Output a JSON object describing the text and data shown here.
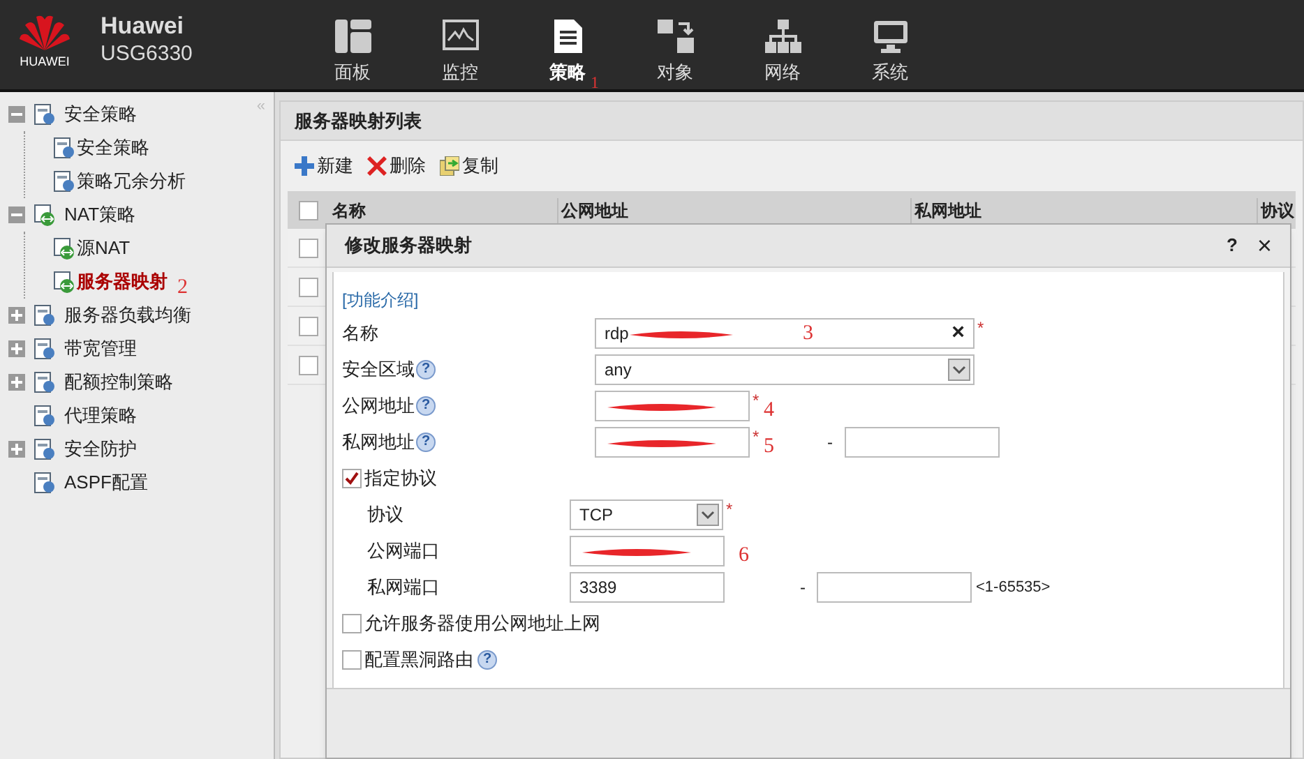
{
  "header": {
    "logo_text": "HUAWEI",
    "brand": "Huawei",
    "model": "USG6330",
    "nav": [
      {
        "label": "面板",
        "selected": false
      },
      {
        "label": "监控",
        "selected": false
      },
      {
        "label": "策略",
        "selected": true,
        "annotation": "1"
      },
      {
        "label": "对象",
        "selected": false
      },
      {
        "label": "网络",
        "selected": false
      },
      {
        "label": "系统",
        "selected": false
      }
    ]
  },
  "sidebar": {
    "collapse": "«",
    "items": [
      {
        "kind": "folder",
        "label": "安全策略",
        "expanded": true,
        "selected": false,
        "children": [
          {
            "label": "安全策略",
            "selected": false
          },
          {
            "label": "策略冗余分析",
            "selected": false
          }
        ]
      },
      {
        "kind": "folder",
        "label": "NAT策略",
        "expanded": true,
        "selected": false,
        "children": [
          {
            "label": "源NAT",
            "selected": false
          },
          {
            "label": "服务器映射",
            "selected": true,
            "annotation": "2"
          }
        ]
      },
      {
        "kind": "folder",
        "label": "服务器负载均衡",
        "expanded": false,
        "selected": false
      },
      {
        "kind": "folder",
        "label": "带宽管理",
        "expanded": false,
        "selected": false
      },
      {
        "kind": "folder",
        "label": "配额控制策略",
        "expanded": false,
        "selected": false
      },
      {
        "kind": "page",
        "label": "代理策略",
        "selected": false
      },
      {
        "kind": "folder",
        "label": "安全防护",
        "expanded": false,
        "selected": false
      },
      {
        "kind": "page",
        "label": "ASPF配置",
        "selected": false
      }
    ]
  },
  "panel": {
    "title": "服务器映射列表",
    "toolbar": [
      {
        "label": "新建"
      },
      {
        "label": "删除"
      },
      {
        "label": "复制"
      }
    ],
    "table": {
      "select_all": {
        "checked": false
      },
      "columns": [
        "名称",
        "公网地址",
        "私网地址",
        "协议"
      ],
      "rows": [
        {
          "checked": false
        },
        {
          "checked": false
        },
        {
          "checked": false
        },
        {
          "checked": false
        }
      ]
    }
  },
  "dialog": {
    "title": "修改服务器映射",
    "help": "?",
    "close": "×",
    "link": "[功能介绍]",
    "fields": [
      {
        "kind": "text-clear",
        "label": "名称",
        "value": "rdp",
        "redacted": true,
        "required": "*",
        "clear": "×",
        "annotation": "3"
      },
      {
        "kind": "select-wide",
        "label": "安全区域",
        "help": "?",
        "value": "any"
      },
      {
        "kind": "text",
        "label": "公网地址",
        "help": "?",
        "redacted": true,
        "required": "*",
        "annotation": "4"
      },
      {
        "kind": "text-range",
        "label": "私网地址",
        "help": "?",
        "redacted": true,
        "required": "*",
        "separator": "-",
        "annotation": "5"
      },
      {
        "kind": "checkbox",
        "label": "指定协议",
        "checked": true,
        "children": [
          {
            "kind": "select",
            "label": "协议",
            "value": "TCP",
            "required": "*"
          },
          {
            "kind": "text",
            "label": "公网端口",
            "redacted": true,
            "annotation": "6"
          },
          {
            "kind": "text-range",
            "label": "私网端口",
            "value": "3389",
            "separator": "-",
            "hint": "<1-65535>"
          }
        ]
      },
      {
        "kind": "checkbox",
        "label": "允许服务器使用公网地址上网",
        "checked": false
      },
      {
        "kind": "checkbox",
        "label": "配置黑洞路由",
        "checked": false,
        "help": "?"
      }
    ]
  }
}
